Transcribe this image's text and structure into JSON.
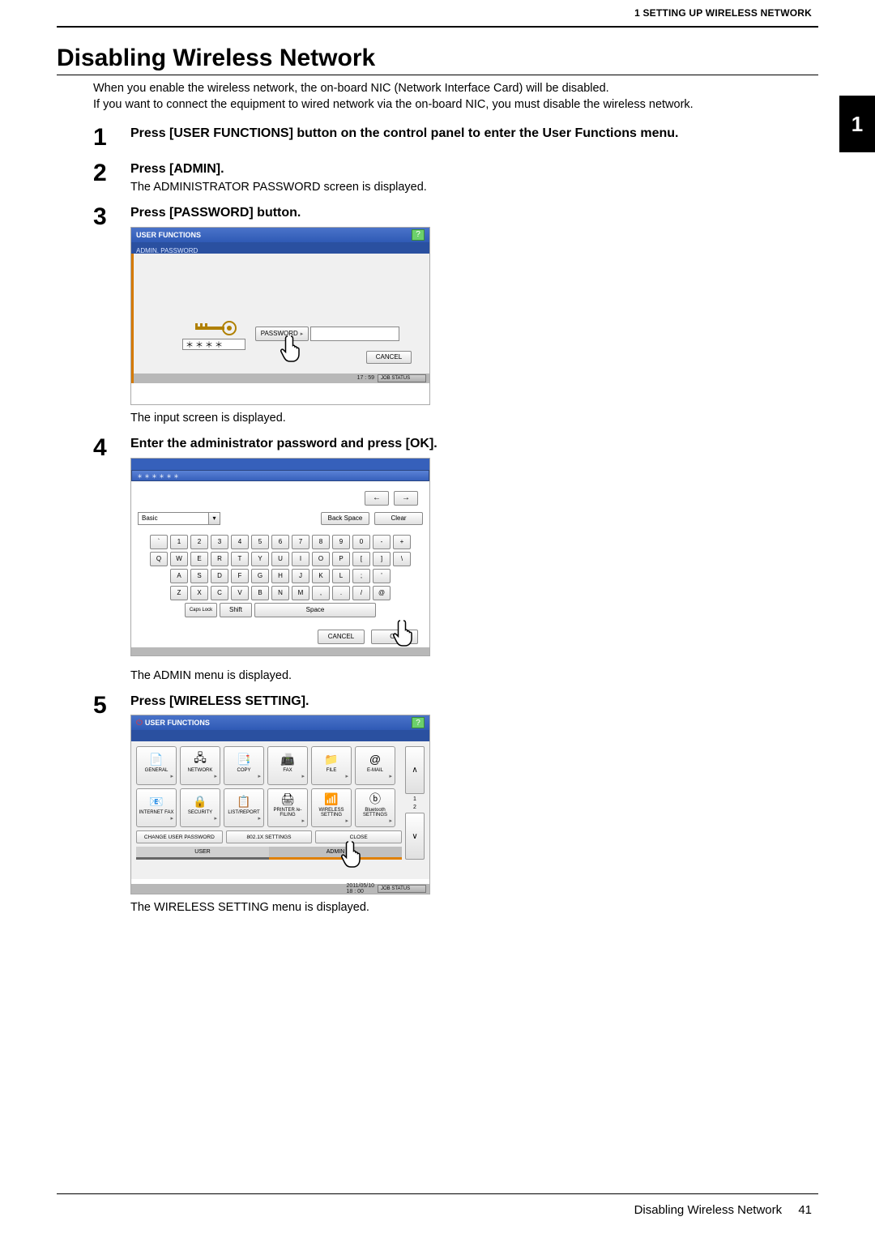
{
  "header": {
    "label": "1 SETTING UP WIRELESS NETWORK"
  },
  "chapter_tab": "1",
  "title": "Disabling Wireless Network",
  "intro": [
    "When you enable the wireless network, the on-board NIC (Network Interface Card) will be disabled.",
    "If you want to connect the equipment to wired network via the on-board NIC, you must disable the wireless network."
  ],
  "steps": [
    {
      "n": "1",
      "head": "Press [USER FUNCTIONS] button on the control panel to enter the User Functions menu."
    },
    {
      "n": "2",
      "head": "Press [ADMIN].",
      "note": "The ADMINISTRATOR PASSWORD screen is displayed."
    },
    {
      "n": "3",
      "head": "Press [PASSWORD] button.",
      "after": "The input screen is displayed."
    },
    {
      "n": "4",
      "head": "Enter the administrator password and press [OK].",
      "after": "The ADMIN menu is displayed."
    },
    {
      "n": "5",
      "head": "Press [WIRELESS SETTING].",
      "after": "The WIRELESS SETTING menu is displayed."
    }
  ],
  "shot1": {
    "titlebar": "USER FUNCTIONS",
    "help": "?",
    "subbar": "ADMIN. PASSWORD",
    "mask": "＊＊＊＊",
    "pwd_btn": "PASSWORD",
    "cancel": "CANCEL",
    "time": "17 : 59",
    "jobstatus": "JOB STATUS"
  },
  "shot2": {
    "mask": "＊＊＊＊＊＊",
    "arrow_left": "←",
    "arrow_right": "→",
    "mode": "Basic",
    "backspace": "Back Space",
    "clear": "Clear",
    "rows": [
      [
        "`",
        "1",
        "2",
        "3",
        "4",
        "5",
        "6",
        "7",
        "8",
        "9",
        "0",
        "-",
        "+"
      ],
      [
        "Q",
        "W",
        "E",
        "R",
        "T",
        "Y",
        "U",
        "I",
        "O",
        "P",
        "[",
        "]",
        "\\"
      ],
      [
        "A",
        "S",
        "D",
        "F",
        "G",
        "H",
        "J",
        "K",
        "L",
        ";",
        "'"
      ],
      [
        "Z",
        "X",
        "C",
        "V",
        "B",
        "N",
        "M",
        ",",
        ".",
        "/",
        "@"
      ]
    ],
    "caps": "Caps Lock",
    "shift": "Shift",
    "space": "Space",
    "cancel": "CANCEL",
    "ok": "OK"
  },
  "shot3": {
    "titlebar": "USER FUNCTIONS",
    "help": "?",
    "tiles_row1": [
      {
        "lbl": "GENERAL"
      },
      {
        "lbl": "NETWORK"
      },
      {
        "lbl": "COPY"
      },
      {
        "lbl": "FAX"
      },
      {
        "lbl": "FILE"
      },
      {
        "lbl": "E-MAIL"
      }
    ],
    "tiles_row2": [
      {
        "lbl": "INTERNET FAX"
      },
      {
        "lbl": "SECURITY"
      },
      {
        "lbl": "LIST/REPORT"
      },
      {
        "lbl": "PRINTER /e-FILING"
      },
      {
        "lbl": "WIRELESS SETTING"
      },
      {
        "lbl": "Bluetooth SETTINGS"
      }
    ],
    "page_ind": [
      "1",
      "2"
    ],
    "bar": [
      "CHANGE USER PASSWORD",
      "802.1X SETTINGS",
      "CLOSE"
    ],
    "tabs": [
      "USER",
      "ADMIN"
    ],
    "date": "2011/05/10",
    "time": "18 : 00",
    "jobstatus": "JOB STATUS"
  },
  "footer": {
    "title": "Disabling Wireless Network",
    "page": "41"
  }
}
